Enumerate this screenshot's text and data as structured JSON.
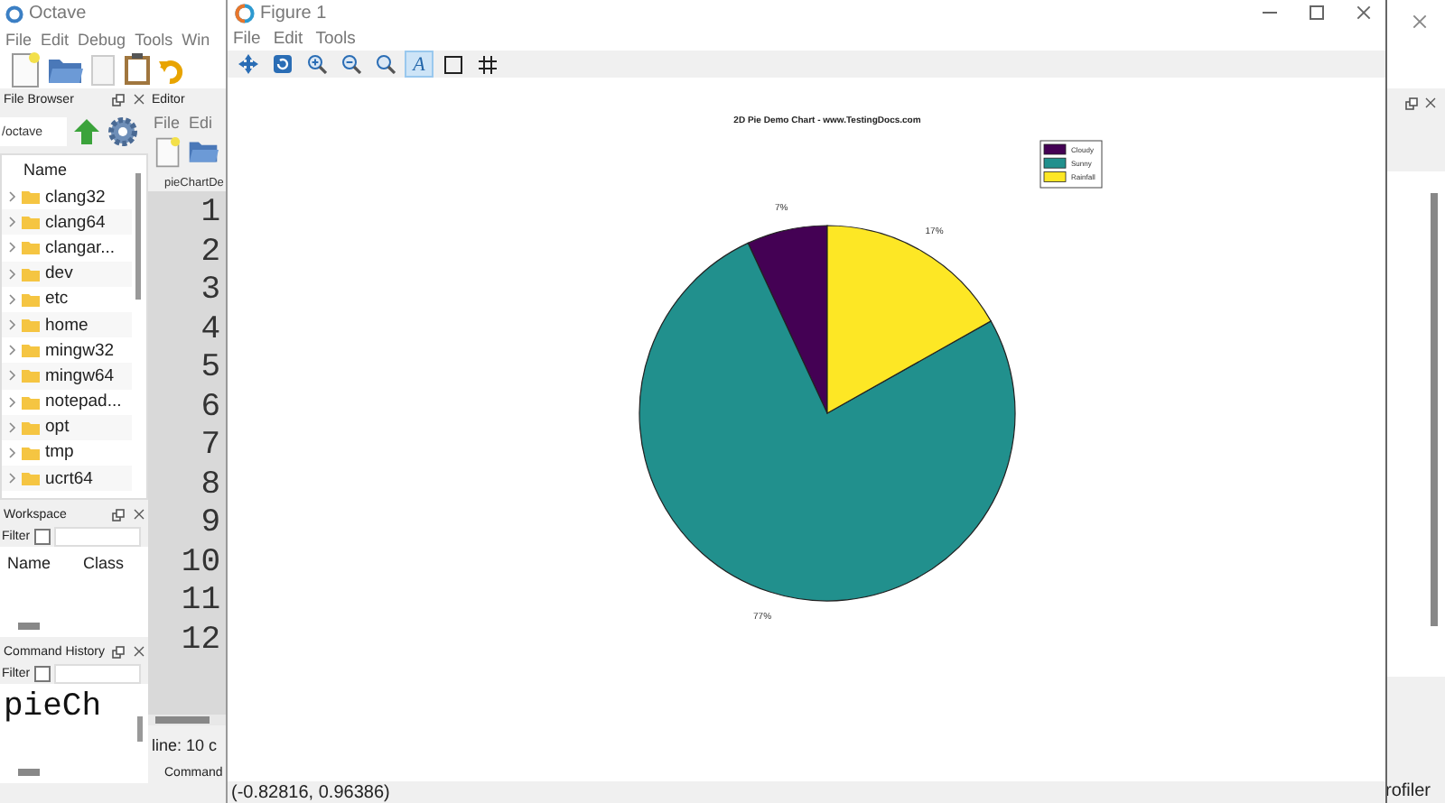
{
  "main_window": {
    "title": "Octave",
    "menu": [
      "File",
      "Edit",
      "Debug",
      "Tools",
      "Win"
    ]
  },
  "file_browser": {
    "title": "File Browser",
    "path": "/octave",
    "column": "Name",
    "items": [
      {
        "name": "clang32"
      },
      {
        "name": "clang64"
      },
      {
        "name": "clangar..."
      },
      {
        "name": "dev"
      },
      {
        "name": "etc"
      },
      {
        "name": "home"
      },
      {
        "name": "mingw32"
      },
      {
        "name": "mingw64"
      },
      {
        "name": "notepad..."
      },
      {
        "name": "opt"
      },
      {
        "name": "tmp"
      },
      {
        "name": "ucrt64"
      }
    ]
  },
  "workspace": {
    "title": "Workspace",
    "filter_label": "Filter",
    "filter_checked": false,
    "columns": [
      "Name",
      "Class"
    ]
  },
  "command_history": {
    "title": "Command History",
    "filter_label": "Filter",
    "filter_checked": false,
    "entries": [
      "pieCh"
    ]
  },
  "editor": {
    "title": "Editor",
    "menu": [
      "File",
      "Edi"
    ],
    "tab": "pieChartDe",
    "line_numbers": [
      "1",
      "2",
      "3",
      "4",
      "5",
      "6",
      "7",
      "8",
      "9",
      "10",
      "11",
      "12"
    ],
    "status": "line: 10  c",
    "bottom_tab": "Command"
  },
  "right_dock": {
    "bottom_tab": "rofiler"
  },
  "figure": {
    "title": "Figure 1",
    "menu": [
      "File",
      "Edit",
      "Tools"
    ],
    "tools": [
      {
        "kind": "pan",
        "selected": false
      },
      {
        "kind": "rotate",
        "selected": false
      },
      {
        "kind": "zoom-in",
        "selected": false
      },
      {
        "kind": "zoom-out",
        "selected": false
      },
      {
        "kind": "zoom",
        "selected": false
      },
      {
        "kind": "text",
        "label": "A",
        "selected": true
      },
      {
        "kind": "box",
        "selected": false
      },
      {
        "kind": "grid",
        "selected": false
      }
    ],
    "chart_data": {
      "type": "pie",
      "title": "2D Pie Demo Chart - www.TestingDocs.com",
      "categories": [
        "Cloudy",
        "Sunny",
        "Rainfall"
      ],
      "values": [
        7,
        77,
        17
      ],
      "colors": [
        "#440154",
        "#21908d",
        "#fde725"
      ],
      "value_labels": [
        "7%",
        "77%",
        "17%"
      ],
      "legend": "upper right"
    },
    "status": "(-0.82816, 0.96386)"
  }
}
